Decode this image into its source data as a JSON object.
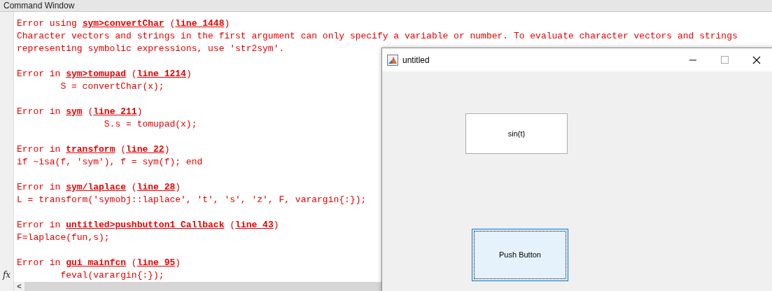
{
  "command_window": {
    "title": "Command Window",
    "blocks": [
      {
        "lines": [
          [
            {
              "kind": "text",
              "text": "Error using "
            },
            {
              "kind": "link",
              "text": "sym>convertChar"
            },
            {
              "kind": "text",
              "text": " ("
            },
            {
              "kind": "link",
              "text": "line 1448"
            },
            {
              "kind": "text",
              "text": ")"
            }
          ],
          [
            {
              "kind": "text",
              "text": "Character vectors and strings in the first argument can only specify a variable or number. To evaluate character vectors and strings"
            }
          ],
          [
            {
              "kind": "text",
              "text": "representing symbolic expressions, use 'str2sym'."
            }
          ]
        ]
      },
      {
        "lines": [
          [
            {
              "kind": "text",
              "text": "Error in "
            },
            {
              "kind": "link",
              "text": "sym>tomupad"
            },
            {
              "kind": "text",
              "text": " ("
            },
            {
              "kind": "link",
              "text": "line 1214"
            },
            {
              "kind": "text",
              "text": ")"
            }
          ],
          [
            {
              "kind": "text",
              "text": "        S = convertChar(x);"
            }
          ]
        ]
      },
      {
        "lines": [
          [
            {
              "kind": "text",
              "text": "Error in "
            },
            {
              "kind": "link",
              "text": "sym"
            },
            {
              "kind": "text",
              "text": " ("
            },
            {
              "kind": "link",
              "text": "line 211"
            },
            {
              "kind": "text",
              "text": ")"
            }
          ],
          [
            {
              "kind": "text",
              "text": "                S.s = tomupad(x);"
            }
          ]
        ]
      },
      {
        "lines": [
          [
            {
              "kind": "text",
              "text": "Error in "
            },
            {
              "kind": "link",
              "text": "transform"
            },
            {
              "kind": "text",
              "text": " ("
            },
            {
              "kind": "link",
              "text": "line 22"
            },
            {
              "kind": "text",
              "text": ")"
            }
          ],
          [
            {
              "kind": "text",
              "text": "if ~isa(f, 'sym'), f = sym(f); end"
            }
          ]
        ]
      },
      {
        "lines": [
          [
            {
              "kind": "text",
              "text": "Error in "
            },
            {
              "kind": "link",
              "text": "sym/laplace"
            },
            {
              "kind": "text",
              "text": " ("
            },
            {
              "kind": "link",
              "text": "line 28"
            },
            {
              "kind": "text",
              "text": ")"
            }
          ],
          [
            {
              "kind": "text",
              "text": "L = transform('symobj::laplace', 't', 's', 'z', F, varargin{:});"
            }
          ]
        ]
      },
      {
        "lines": [
          [
            {
              "kind": "text",
              "text": "Error in "
            },
            {
              "kind": "link",
              "text": "untitled>pushbutton1_Callback"
            },
            {
              "kind": "text",
              "text": " ("
            },
            {
              "kind": "link",
              "text": "line 43"
            },
            {
              "kind": "text",
              "text": ")"
            }
          ],
          [
            {
              "kind": "text",
              "text": "F=laplace(fun,s);"
            }
          ]
        ]
      },
      {
        "lines": [
          [
            {
              "kind": "text",
              "text": "Error in "
            },
            {
              "kind": "link",
              "text": "gui_mainfcn"
            },
            {
              "kind": "text",
              "text": " ("
            },
            {
              "kind": "link",
              "text": "line 95"
            },
            {
              "kind": "text",
              "text": ")"
            }
          ],
          [
            {
              "kind": "text",
              "text": "        feval(varargin{:});"
            }
          ]
        ]
      }
    ],
    "prompt_icon": "fx",
    "scroll_left": "<"
  },
  "figure": {
    "title": "untitled",
    "edit_text": "sin(t)",
    "button": "Push Button"
  }
}
